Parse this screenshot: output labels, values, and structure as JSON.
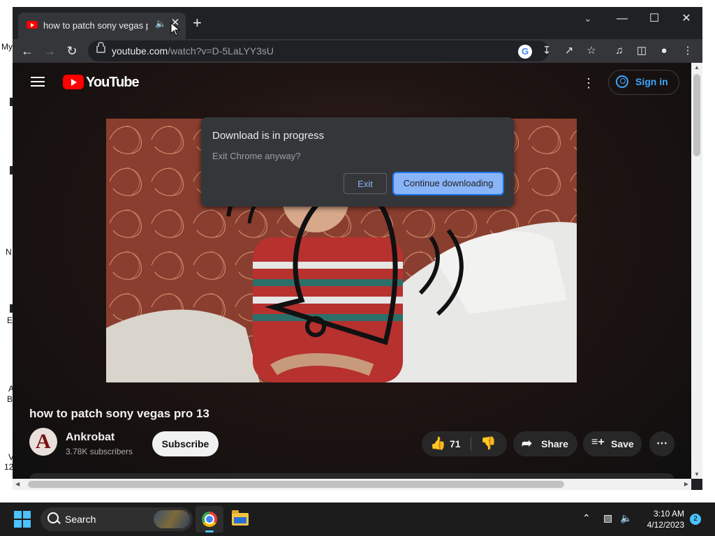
{
  "desktop": {
    "labels": [
      "My",
      "N",
      "E",
      "A",
      "B",
      "V",
      "12"
    ]
  },
  "browser": {
    "tab": {
      "title": "how to patch sony vegas pro 13",
      "audio_icon": "speaker-icon",
      "close_icon": "close-icon"
    },
    "new_tab_icon": "plus-icon",
    "window_controls": {
      "tab_search": "chevron-down-icon",
      "minimize": "minimize-icon",
      "maximize": "maximize-icon",
      "close": "close-icon"
    },
    "nav": {
      "back": "back-icon",
      "forward": "forward-icon",
      "reload": "reload-icon"
    },
    "omnibox": {
      "host": "youtube.com",
      "path": "/watch?v=D-5LaLYY3sU"
    },
    "toolbar_icons": [
      "google-lens-icon",
      "install-app-icon",
      "share-icon",
      "bookmark-star-icon",
      "media-control-icon",
      "side-panel-icon",
      "profile-icon",
      "kebab-menu-icon"
    ]
  },
  "youtube": {
    "logo_text": "YouTube",
    "sign_in": "Sign in",
    "video_title": "how to patch sony vegas pro 13",
    "channel": {
      "name": "Ankrobat",
      "subscribers": "3.78K subscribers",
      "avatar_letter": "A"
    },
    "subscribe_label": "Subscribe",
    "likes": "71",
    "share_label": "Share",
    "save_label": "Save"
  },
  "dialog": {
    "title": "Download is in progress",
    "message": "Exit Chrome anyway?",
    "exit_label": "Exit",
    "continue_label": "Continue downloading"
  },
  "taskbar": {
    "search_label": "Search",
    "time": "3:10 AM",
    "date": "4/12/2023",
    "notification_count": "2",
    "accent": "#4cc2ff"
  }
}
